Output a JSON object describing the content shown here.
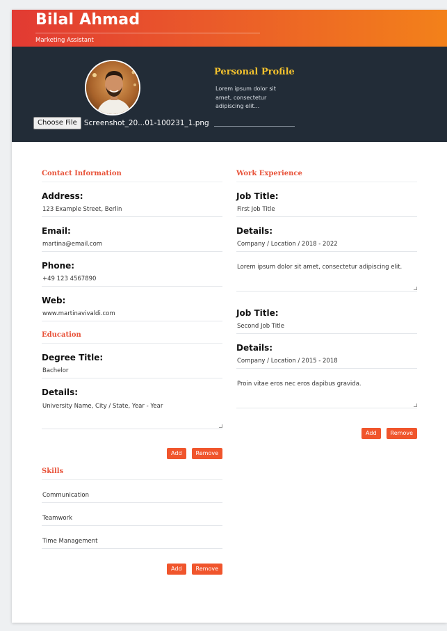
{
  "header": {
    "name": "Bilal Ahmad",
    "role": "Marketing Assistant"
  },
  "profile": {
    "file_button": "Choose File",
    "file_name": "Screenshot_20...01-100231_1.png",
    "title": "Personal Profile",
    "text": "Lorem ipsum dolor sit amet, consectetur adipiscing elit..."
  },
  "contact": {
    "title": "Contact Information",
    "fields": [
      {
        "label": "Address:",
        "value": "123 Example Street, Berlin"
      },
      {
        "label": "Email:",
        "value": "martina@email.com"
      },
      {
        "label": "Phone:",
        "value": "+49 123 4567890"
      },
      {
        "label": "Web:",
        "value": "www.martinavivaldi.com"
      }
    ]
  },
  "education": {
    "title": "Education",
    "degree_label": "Degree Title:",
    "degree_value": "Bachelor",
    "details_label": "Details:",
    "details_value": "University Name, City / State, Year - Year",
    "add_label": "Add",
    "remove_label": "Remove"
  },
  "skills": {
    "title": "Skills",
    "items": [
      "Communication",
      "Teamwork",
      "Time Management"
    ],
    "add_label": "Add",
    "remove_label": "Remove"
  },
  "work": {
    "title": "Work Experience",
    "jobs": [
      {
        "title_label": "Job Title:",
        "title_value": "First Job Title",
        "details_label": "Details:",
        "details_value": "Company / Location / 2018 - 2022",
        "description": "Lorem ipsum dolor sit amet, consectetur adipiscing elit."
      },
      {
        "title_label": "Job Title:",
        "title_value": "Second Job Title",
        "details_label": "Details:",
        "details_value": "Company / Location / 2015 - 2018",
        "description": "Proin vitae eros nec eros dapibus gravida."
      }
    ],
    "add_label": "Add",
    "remove_label": "Remove"
  },
  "colors": {
    "accent": "#e8533a",
    "header_gradient_start": "#e23a33",
    "header_gradient_end": "#f3811a",
    "dark_band": "#222c37",
    "profile_title": "#f2c12e",
    "button": "#f0552c"
  }
}
